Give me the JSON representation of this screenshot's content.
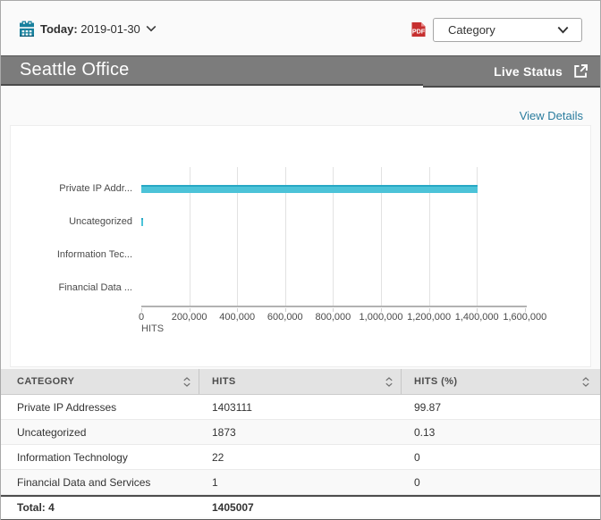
{
  "topbar": {
    "date_prefix": "Today:",
    "date_value": "2019-01-30",
    "category_select_value": "Category"
  },
  "titlebar": {
    "title": "Seattle Office",
    "live_status_label": "Live Status"
  },
  "content": {
    "view_details_label": "View Details"
  },
  "chart_data": {
    "type": "bar",
    "orientation": "horizontal",
    "categories": [
      "Private IP Addr...",
      "Uncategorized",
      "Information Tec...",
      "Financial Data ..."
    ],
    "values": [
      1403111,
      1873,
      22,
      1
    ],
    "xlabel": "HITS",
    "ylabel": "",
    "xlim": [
      0,
      1600000
    ],
    "x_ticks": [
      0,
      200000,
      400000,
      600000,
      800000,
      1000000,
      1200000,
      1400000,
      1600000
    ],
    "x_tick_labels": [
      "0",
      "200,000",
      "400,000",
      "600,000",
      "800,000",
      "1,000,000",
      "1,200,000",
      "1,400,000",
      "1,600,000"
    ],
    "grid": true,
    "bar_color": "#4cc3d8",
    "bar_edge_color": "#28a8c5"
  },
  "table": {
    "columns": [
      "CATEGORY",
      "HITS",
      "HITS (%)"
    ],
    "rows": [
      [
        "Private IP Addresses",
        "1403111",
        "99.87"
      ],
      [
        "Uncategorized",
        "1873",
        "0.13"
      ],
      [
        "Information Technology",
        "22",
        "0"
      ],
      [
        "Financial Data and Services",
        "1",
        "0"
      ]
    ],
    "total_row": [
      "Total: 4",
      "1405007",
      ""
    ]
  },
  "icons": {
    "calendar": "calendar-icon",
    "pdf": "pdf-export-icon",
    "chevron": "chevron-down-icon",
    "external": "external-link-icon",
    "sort": "sort-icon"
  },
  "colors": {
    "accent_teal": "#17809d",
    "link_teal": "#2a7c9e",
    "bar_cyan": "#4cc3d8",
    "titlebar_gray": "#7c7c7c",
    "pdf_red": "#c62f2f",
    "table_header_gray": "#e3e3e3"
  }
}
